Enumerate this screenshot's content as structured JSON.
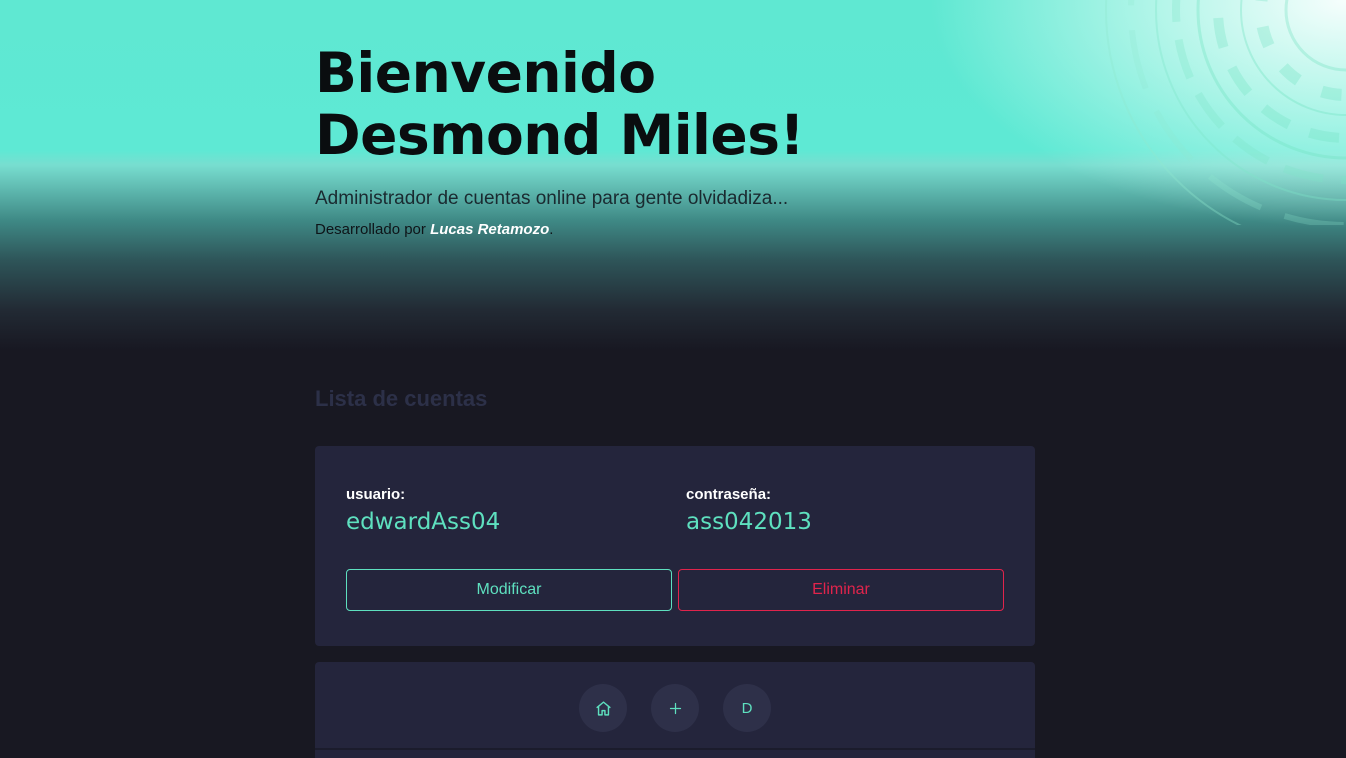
{
  "hero": {
    "title": "Bienvenido Desmond Miles!",
    "subtitle": "Administrador de cuentas online para gente olvidadiza...",
    "credit_prefix": "Desarrollado por ",
    "credit_author": "Lucas Retamozo",
    "credit_suffix": "."
  },
  "accounts": {
    "section_title": "Lista de cuentas",
    "items": [
      {
        "user_label": "usuario:",
        "user_value": "edwardAss04",
        "password_label": "contraseña:",
        "password_value": "ass042013",
        "modify_label": "Modificar",
        "delete_label": "Eliminar"
      }
    ]
  },
  "navbar": {
    "home_icon": "home-icon",
    "add_icon": "plus-icon",
    "profile_initial": "D"
  },
  "colors": {
    "accent": "#5ee0bf",
    "danger": "#e0244c",
    "background": "#181822",
    "card": "#24253c"
  }
}
